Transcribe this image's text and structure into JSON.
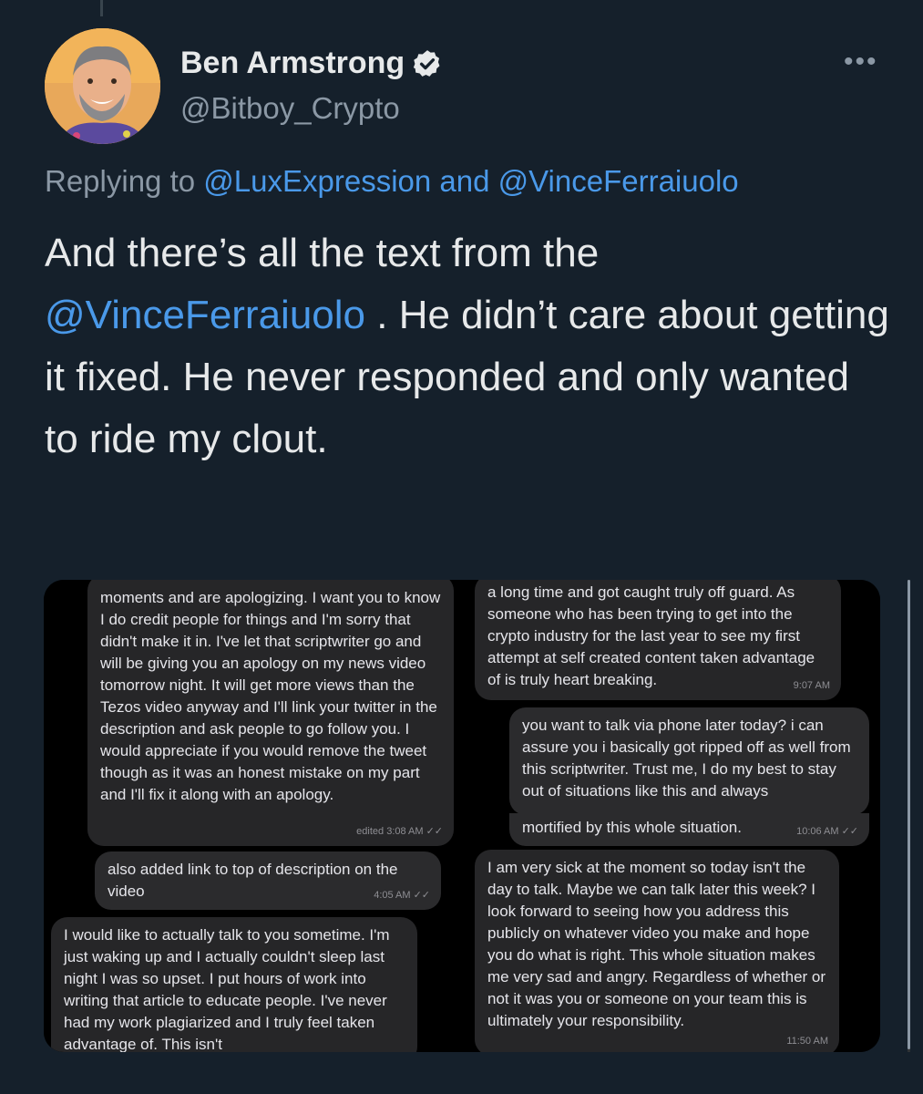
{
  "author": {
    "name": "Ben Armstrong",
    "handle": "@Bitboy_Crypto"
  },
  "reply": {
    "prefix": "Replying to",
    "mention1": "@LuxExpression",
    "conjunction": "and",
    "mention2": "@VinceFerraiuolo"
  },
  "tweet": {
    "line1": "And there’s all the text from the",
    "mention": "@VinceFerraiuolo",
    "rest": ". He didn’t care about getting it fixed. He never responded and only wanted to ride my clout."
  },
  "more_icon": "•••",
  "screenshots": {
    "left": [
      {
        "id": "m1",
        "text": "moments and are apologizing. I want you to know I do credit people for things and I'm sorry that didn't make it in. I've let that scriptwriter go and will be giving you an apology on my news video tomorrow night. It will get more views than the Tezos video anyway and I'll link your twitter in the description and ask people to go follow you. I would appreciate if you would remove the tweet though as it was an honest mistake on my part and I'll fix it along with an apology.",
        "meta": "edited 3:08 AM"
      },
      {
        "id": "m2",
        "text": "also added link to top of description on the video",
        "meta": "4:05 AM"
      },
      {
        "id": "m3",
        "text": "I would like to actually talk to you sometime. I'm just waking up and I actually couldn't sleep last night I was so upset. I put hours of work into writing that article to educate people. I've never had my work plagiarized and I truly feel taken advantage of. This isn't",
        "meta": ""
      }
    ],
    "right": [
      {
        "id": "r1",
        "text": "a long time and got caught truly off guard. As someone who has been trying to get into the crypto industry for the last year to see my first attempt at self created content taken advantage of is truly heart breaking.",
        "meta": "9:07 AM"
      },
      {
        "id": "r2",
        "text": "you want to talk via phone later today? i can assure you i basically got ripped off as well from this scriptwriter. Trust me, I do my best to stay out of situations like this and always",
        "meta": ""
      },
      {
        "id": "r2b",
        "text": "mortified by this whole situation.",
        "meta": "10:06 AM"
      },
      {
        "id": "r3",
        "text": "I am very sick at the moment so today isn't the day to talk. Maybe we can talk later this week? I look forward to seeing how you address this publicly on whatever video you make and hope you do what is right. This whole situation makes me very sad and angry. Regardless of whether or not it was you or someone on your team this is ultimately your responsibility.",
        "meta": "11:50 AM"
      }
    ]
  }
}
